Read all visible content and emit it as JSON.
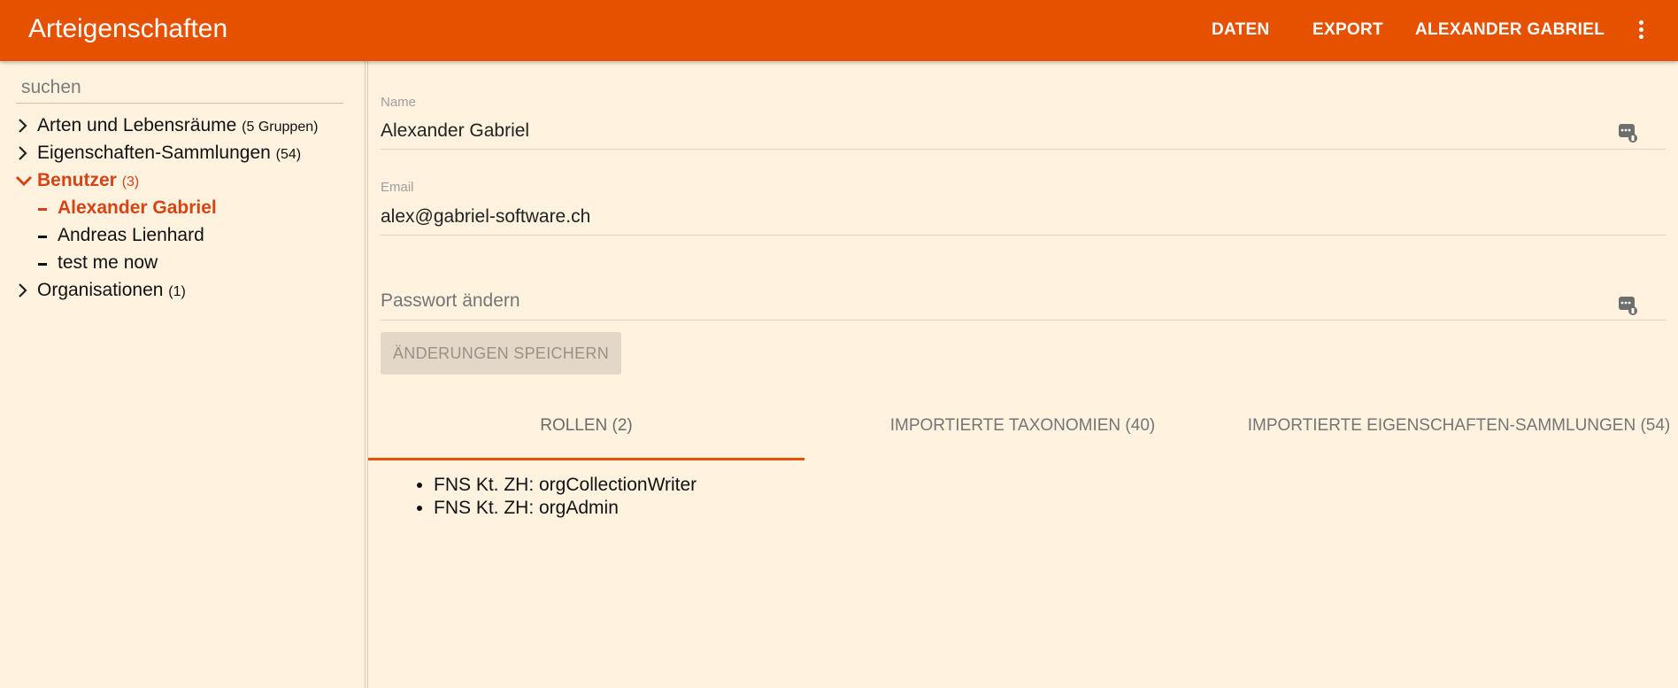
{
  "app": {
    "title": "Arteigenschaften"
  },
  "nav": {
    "daten": "DATEN",
    "export": "EXPORT",
    "user": "ALEXANDER GABRIEL"
  },
  "sidebar": {
    "search_placeholder": "suchen",
    "items": [
      {
        "label": "Arten und Lebensräume",
        "count": "(5 Gruppen)"
      },
      {
        "label": "Eigenschaften-Sammlungen",
        "count": "(54)"
      },
      {
        "label": "Benutzer",
        "count": "(3)"
      },
      {
        "label": "Alexander Gabriel"
      },
      {
        "label": "Andreas Lienhard"
      },
      {
        "label": "test me now"
      },
      {
        "label": "Organisationen",
        "count": "(1)"
      }
    ]
  },
  "form": {
    "name_label": "Name",
    "name_value": "Alexander Gabriel",
    "email_label": "Email",
    "email_value": "alex@gabriel-software.ch",
    "password_placeholder": "Passwort ändern",
    "save_label": "ÄNDERUNGEN SPEICHERN"
  },
  "tabs": [
    {
      "label": "ROLLEN (2)"
    },
    {
      "label": "IMPORTIERTE TAXONOMIEN (40)"
    },
    {
      "label": "IMPORTIERTE EIGENSCHAFTEN-SAMMLUNGEN (54)"
    }
  ],
  "roles": [
    "FNS Kt. ZH: orgCollectionWriter",
    "FNS Kt. ZH: orgAdmin"
  ],
  "colors": {
    "appbar": "#e65100",
    "background": "#fff3e0",
    "active": "#d84315"
  },
  "icons": {
    "menu": "more-vert-icon",
    "chevron_right": "chevron-right-icon",
    "chevron_down": "chevron-down-icon",
    "password_key": "key-icon"
  }
}
